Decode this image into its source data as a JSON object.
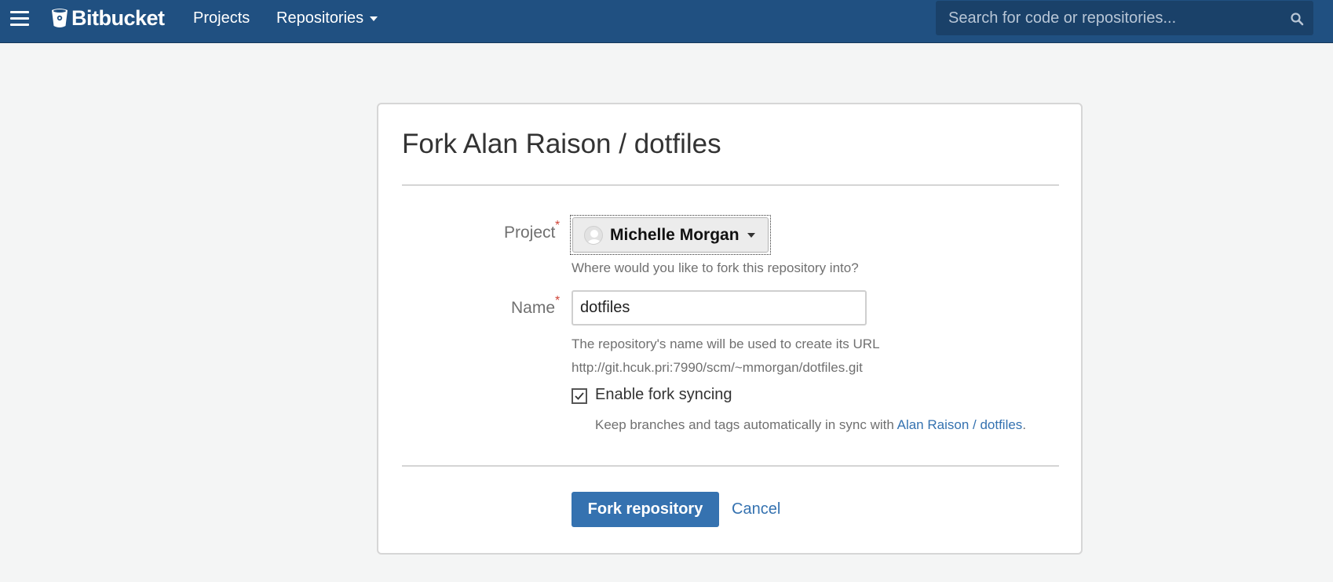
{
  "header": {
    "menu_icon": "hamburger-menu-icon",
    "logo_icon": "bitbucket-bucket-icon",
    "logo_text": "Bitbucket",
    "nav": [
      {
        "label": "Projects"
      },
      {
        "label": "Repositories",
        "has_dropdown": true
      }
    ],
    "search": {
      "placeholder": "Search for code or repositories...",
      "icon": "search-icon"
    },
    "colors": {
      "bar": "#205081",
      "search_bg": "#1a4169"
    }
  },
  "form": {
    "title": "Fork Alan Raison / dotfiles",
    "project": {
      "label": "Project",
      "required_mark": "*",
      "selected": "Michelle Morgan",
      "avatar_icon": "user-avatar-icon",
      "help": "Where would you like to fork this repository into?"
    },
    "name": {
      "label": "Name",
      "required_mark": "*",
      "value": "dotfiles",
      "help": "The repository's name will be used to create its URL",
      "url": "http://git.hcuk.pri:7990/scm/~mmorgan/dotfiles.git"
    },
    "sync": {
      "checked": true,
      "label": "Enable fork syncing",
      "help_prefix": "Keep branches and tags automatically in sync with ",
      "help_link": "Alan Raison / dotfiles",
      "help_suffix": "."
    },
    "actions": {
      "submit": "Fork repository",
      "cancel": "Cancel"
    },
    "colors": {
      "primary": "#3572b0",
      "required": "#d04437"
    }
  }
}
